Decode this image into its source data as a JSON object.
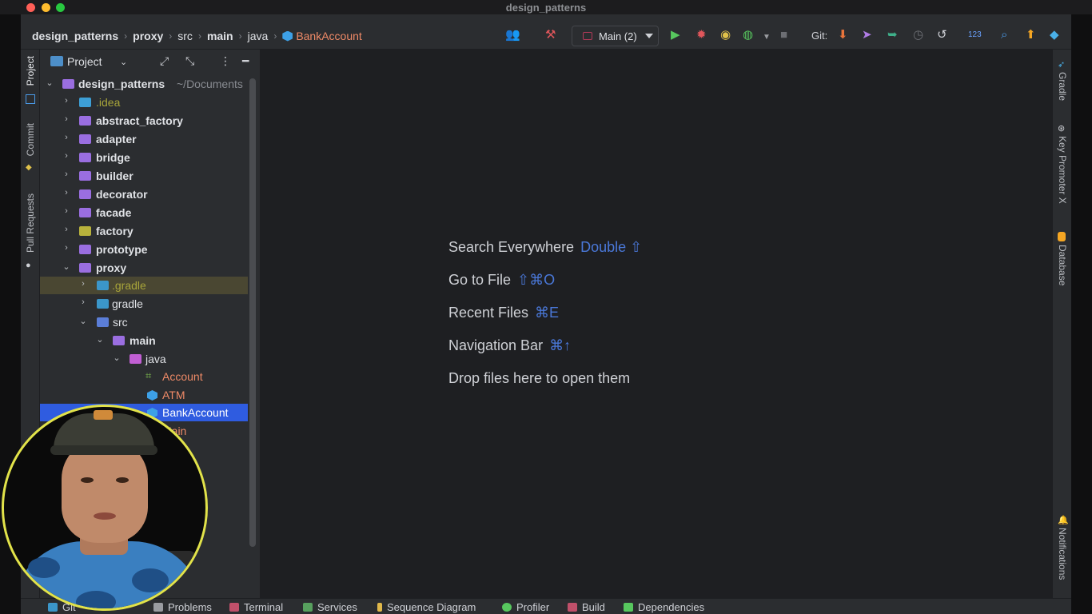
{
  "window": {
    "title": "design_patterns"
  },
  "breadcrumbs": [
    "design_patterns",
    "proxy",
    "src",
    "main",
    "java"
  ],
  "breadcrumb_file": "BankAccount",
  "toolbar": {
    "run_config": "Main (2)",
    "git_label": "Git:",
    "counter": "123"
  },
  "left_tabs": [
    "Project",
    "Commit",
    "Pull Requests"
  ],
  "right_tabs": [
    "Gradle",
    "Key Promoter X",
    "Database",
    "Notifications"
  ],
  "project_panel": {
    "title": "Project",
    "tree": [
      {
        "label": "design_patterns",
        "hint": "~/Documents"
      },
      {
        "label": ".idea"
      },
      {
        "label": "abstract_factory"
      },
      {
        "label": "adapter"
      },
      {
        "label": "bridge"
      },
      {
        "label": "builder"
      },
      {
        "label": "decorator"
      },
      {
        "label": "facade"
      },
      {
        "label": "factory"
      },
      {
        "label": "prototype"
      },
      {
        "label": "proxy"
      },
      {
        "label": ".gradle"
      },
      {
        "label": "gradle"
      },
      {
        "label": "src"
      },
      {
        "label": "main"
      },
      {
        "label": "java"
      },
      {
        "label": "Account"
      },
      {
        "label": "ATM"
      },
      {
        "label": "BankAccount"
      },
      {
        "label": "Main"
      }
    ]
  },
  "editor_hints": [
    {
      "label": "Search Everywhere",
      "shortcut": "Double ⇧"
    },
    {
      "label": "Go to File",
      "shortcut": "⇧⌘O"
    },
    {
      "label": "Recent Files",
      "shortcut": "⌘E"
    },
    {
      "label": "Navigation Bar",
      "shortcut": "⌘↑"
    },
    {
      "label": "Drop files here to open them",
      "shortcut": ""
    }
  ],
  "bottom_tabs": [
    "Git",
    "Problems",
    "Terminal",
    "Services",
    "Sequence Diagram",
    "Profiler",
    "Build",
    "Dependencies"
  ],
  "colors": {
    "accent_selected": "#2f5ce0",
    "modified_file": "#ef8a67",
    "shortcut_blue": "#4a78d9",
    "webcam_ring": "#e2e34a"
  }
}
